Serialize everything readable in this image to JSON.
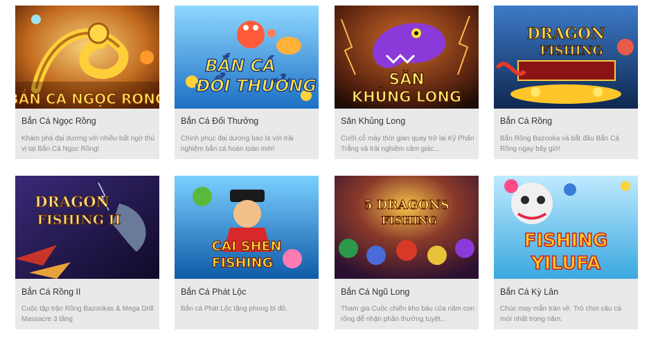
{
  "games": [
    {
      "title": "Bắn Cá Ngọc Rồng",
      "desc": "Khám phá đại dương với nhiều bất ngờ thú vị tại Bắn Cá Ngọc Rồng!",
      "art_text": [
        "BẮN CÁ NGỌC RỒNG"
      ],
      "theme": "#7a3c12",
      "icon": "golden-dragon-art"
    },
    {
      "title": "Bắn Cá Đổi Thưởng",
      "desc": "Chinh phục đại dương bao la với trải nghiệm bắn cá hoàn toàn mới!",
      "art_text": [
        "BẮN CÁ",
        "ĐỔI THƯỞNG"
      ],
      "theme": "#2a8fd6",
      "icon": "crab-fish-art"
    },
    {
      "title": "Săn Khủng Long",
      "desc": "Cưỡi cỗ máy thời gian quay trở lại Kỷ Phấn Trắng và trải nghiệm cảm giác...",
      "art_text": [
        "SĂN",
        "KHỦNG LONG"
      ],
      "theme": "#5a2a14",
      "icon": "purple-dinosaur-art"
    },
    {
      "title": "Bắn Cá Rồng",
      "desc": "Bắn Rồng Bazooka và bắt đầu Bắn Cá Rồng ngay bây giờ!",
      "art_text": [
        "DRAGON",
        "FISHING"
      ],
      "theme": "#1e4f8f",
      "icon": "dragon-fishing-art"
    },
    {
      "title": "Bắn Cá Rồng II",
      "desc": "Cuộc tập trận Rồng Bazookas & Mega Drill Massacre 3 tầng",
      "art_text": [
        "DRAGON",
        "FISHING II"
      ],
      "theme": "#231a4a",
      "icon": "dragon-fishing-2-art"
    },
    {
      "title": "Bắn Cá Phát Lộc",
      "desc": "Bắn cá Phát Lộc tặng phong bì đỏ.",
      "art_text": [
        "CAI SHEN",
        "FISHING"
      ],
      "theme": "#1b8fd0",
      "icon": "caishen-god-art"
    },
    {
      "title": "Bắn Cá Ngũ Long",
      "desc": "Tham gia Cuộc chiến kho báu của năm con rồng để nhận phần thưởng tuyệt...",
      "art_text": [
        "5 DRAGONS",
        "FISHING"
      ],
      "theme": "#3a1f4a",
      "icon": "five-dragons-art"
    },
    {
      "title": "Bắn Cá Kỳ Lân",
      "desc": "Chúc may mắn tràn về. Trò chơi câu cá mới nhất trong năm.",
      "art_text": [
        "FISHING",
        "YILUFA"
      ],
      "theme": "#4cc1e8",
      "icon": "lion-dance-art"
    }
  ]
}
